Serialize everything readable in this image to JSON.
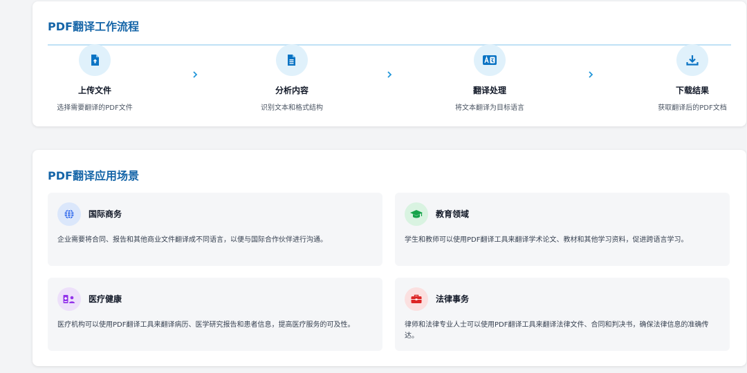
{
  "workflow": {
    "title": "PDF翻译工作流程",
    "steps": [
      {
        "title": "上传文件",
        "desc": "选择需要翻译的PDF文件",
        "icon": "file-upload-icon"
      },
      {
        "title": "分析内容",
        "desc": "识别文本和格式结构",
        "icon": "document-text-icon"
      },
      {
        "title": "翻译处理",
        "desc": "将文本翻译为目标语言",
        "icon": "translate-icon"
      },
      {
        "title": "下载结果",
        "desc": "获取翻译后的PDF文档",
        "icon": "download-icon"
      }
    ],
    "arrow_icon": "chevron-right-icon",
    "accent_color": "#1565a8",
    "icon_color": "#0b74c4"
  },
  "scenarios": {
    "title": "PDF翻译应用场景",
    "items": [
      {
        "title": "国际商务",
        "desc": "企业需要将合同、报告和其他商业文件翻译成不同语言，以便与国际合作伙伴进行沟通。",
        "icon": "globe-icon",
        "color": "#2563eb",
        "bg": "#dbe7fb"
      },
      {
        "title": "教育领域",
        "desc": "学生和教师可以使用PDF翻译工具来翻译学术论文、教材和其他学习资料，促进跨语言学习。",
        "icon": "graduation-cap-icon",
        "color": "#16a34a",
        "bg": "#d9f3e1"
      },
      {
        "title": "医疗健康",
        "desc": "医疗机构可以使用PDF翻译工具来翻译病历、医学研究报告和患者信息，提高医疗服务的可及性。",
        "icon": "medical-id-icon",
        "color": "#9333ea",
        "bg": "#ede0fa"
      },
      {
        "title": "法律事务",
        "desc": "律师和法律专业人士可以使用PDF翻译工具来翻译法律文件、合同和判决书，确保法律信息的准确传达。",
        "icon": "briefcase-icon",
        "color": "#dc2626",
        "bg": "#fbe0e0"
      }
    ]
  }
}
